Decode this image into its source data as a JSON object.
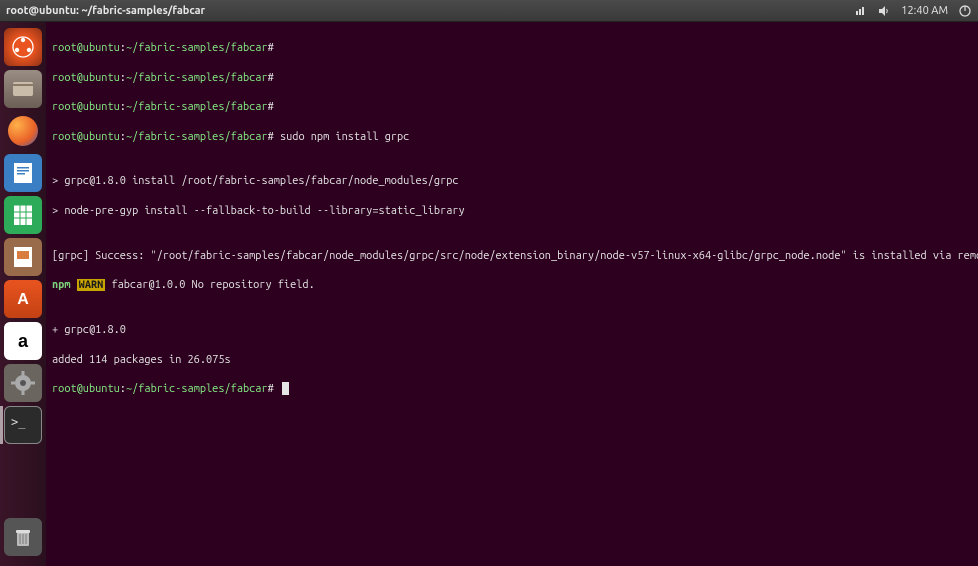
{
  "topbar": {
    "title": "root@ubuntu: ~/fabric-samples/fabcar",
    "time": "12:40 AM"
  },
  "launcher": {
    "items": [
      {
        "name": "dash-icon",
        "label": "Dash"
      },
      {
        "name": "files-icon",
        "label": "Files"
      },
      {
        "name": "firefox-icon",
        "label": "Firefox"
      },
      {
        "name": "libreoffice-writer-icon",
        "label": "LibreOffice Writer"
      },
      {
        "name": "libreoffice-calc-icon",
        "label": "LibreOffice Calc"
      },
      {
        "name": "libreoffice-impress-icon",
        "label": "LibreOffice Impress"
      },
      {
        "name": "ubuntu-software-icon",
        "label": "Ubuntu Software"
      },
      {
        "name": "amazon-icon",
        "label": "Amazon"
      },
      {
        "name": "system-settings-icon",
        "label": "System Settings"
      },
      {
        "name": "terminal-icon",
        "label": "Terminal"
      }
    ],
    "trash": {
      "name": "trash-icon",
      "label": "Trash"
    }
  },
  "terminal": {
    "prompt_user": "root@ubuntu",
    "prompt_sep1": ":",
    "prompt_path": "~/fabric-samples/fabcar",
    "prompt_hash": "#",
    "lines": {
      "l1_cmd": "",
      "l2_cmd": "",
      "l3_cmd": "",
      "l4_cmd": "sudo npm install grpc",
      "blank1": "",
      "l5": "> grpc@1.8.0 install /root/fabric-samples/fabcar/node_modules/grpc",
      "l6": "> node-pre-gyp install --fallback-to-build --library=static_library",
      "blank2": "",
      "l7": "[grpc] Success: \"/root/fabric-samples/fabcar/node_modules/grpc/src/node/extension_binary/node-v57-linux-x64-glibc/grpc_node.node\" is installed via remote",
      "npm_label": "npm",
      "warn_label": "WARN",
      "warn_text": " fabcar@1.0.0 No repository field.",
      "blank3": "",
      "l8": "+ grpc@1.8.0",
      "l9": "added 114 packages in 26.075s",
      "l10_cmd": ""
    }
  }
}
